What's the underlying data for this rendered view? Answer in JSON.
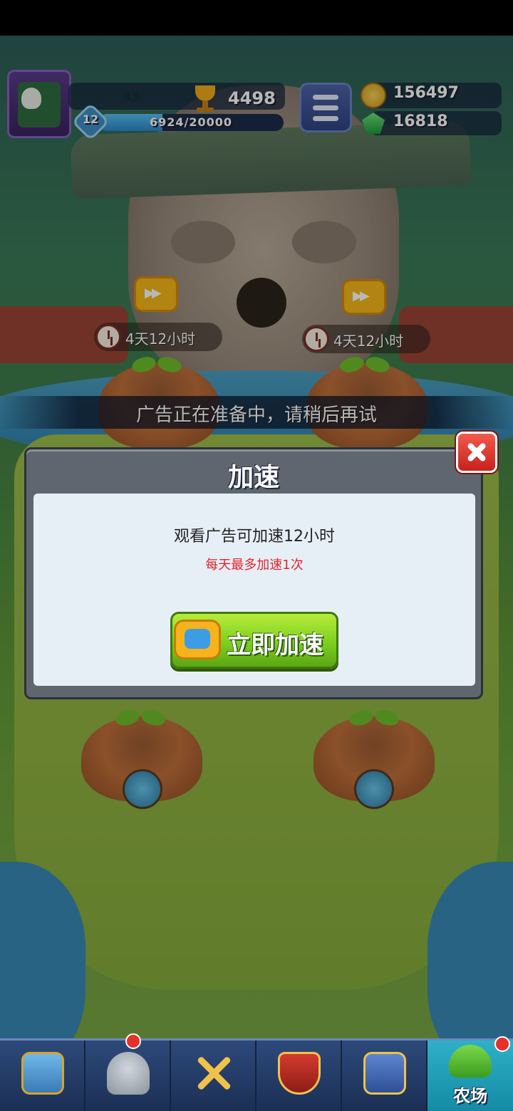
{
  "hud": {
    "player_level_value": "45",
    "trophies": "4498",
    "account_level": "12",
    "xp_text": "6924/20000",
    "xp_progress": 0.3462,
    "coins": "156497",
    "gems": "16818"
  },
  "farm": {
    "timers": [
      {
        "text": "4天12小时"
      },
      {
        "text": "4天12小时"
      }
    ]
  },
  "toast": {
    "text": "广告正在准备中，请稍后再试"
  },
  "dialog": {
    "title": "加速",
    "message": "观看广告可加速12小时",
    "note": "每天最多加速1次",
    "button_label": "立即加速"
  },
  "nav": {
    "tabs": [
      {
        "icon": "treasure-chest-icon"
      },
      {
        "icon": "helmet-icon"
      },
      {
        "icon": "crossed-swords-icon"
      },
      {
        "icon": "crown-shield-icon"
      },
      {
        "icon": "team-banner-icon"
      },
      {
        "icon": "sprout-icon",
        "label": "农场",
        "active": true
      }
    ]
  },
  "colors": {
    "dialog_frame": "#5f6670",
    "dialog_body": "#e6eff6",
    "note_red": "#e3262a",
    "button_green": "#78cc1e",
    "close_red": "#c8211c",
    "nav_blue": "#2d4a7a",
    "active_tab": "#2fb0c8"
  }
}
